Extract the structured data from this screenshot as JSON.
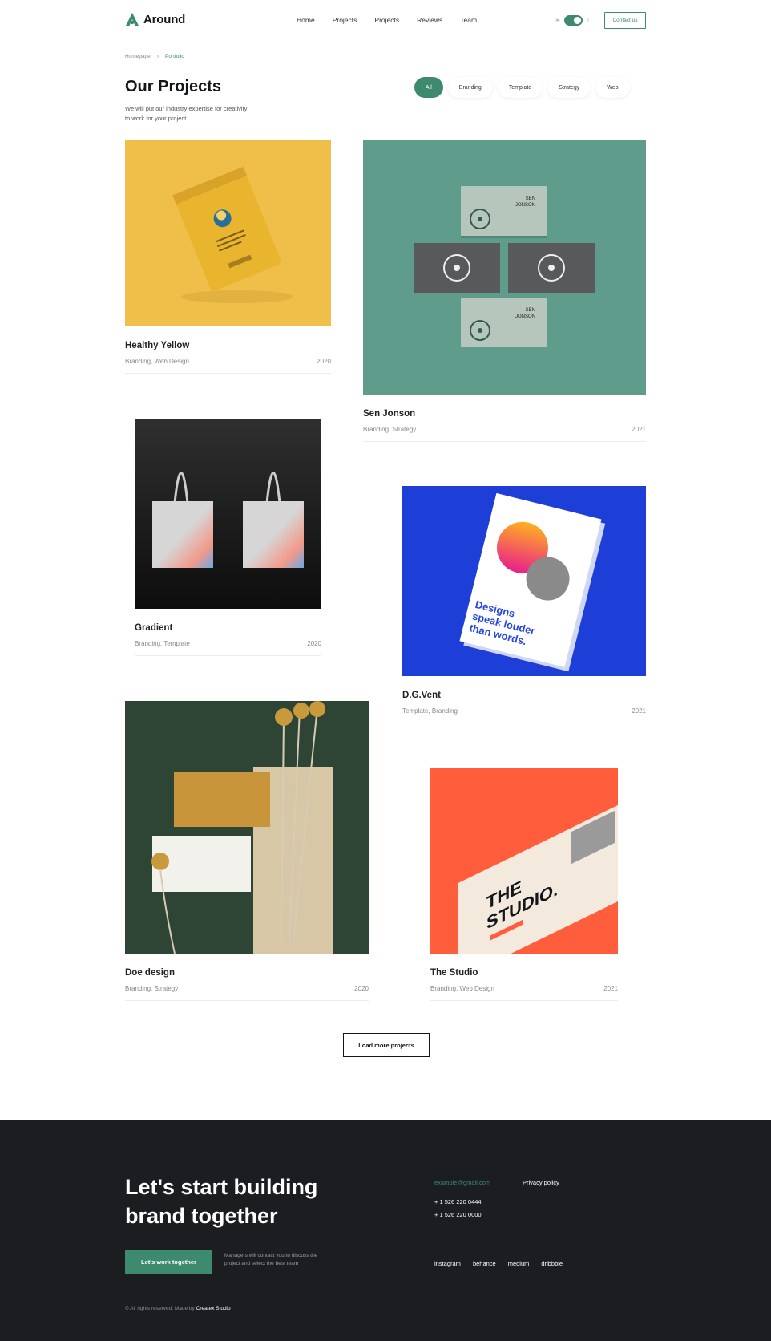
{
  "header": {
    "logo_text": "Around",
    "nav": [
      "Home",
      "Projects",
      "Projects",
      "Reviews",
      "Team"
    ],
    "contact_label": "Contact us"
  },
  "breadcrumb": {
    "home": "Homepage",
    "current": "Portfolio"
  },
  "page": {
    "title": "Our Projects",
    "subtitle": "We will put our industry expertise for creativity to work for your project"
  },
  "filters": [
    "All",
    "Branding",
    "Template",
    "Strategy",
    "Web"
  ],
  "projects": [
    {
      "name": "Healthy Yellow",
      "tags": "Branding, Web Design",
      "year": "2020"
    },
    {
      "name": "Sen Jonson",
      "tags": "Branding, Strategy",
      "year": "2021"
    },
    {
      "name": "Gradient",
      "tags": "Branding, Template",
      "year": "2020"
    },
    {
      "name": "D.G.Vent",
      "tags": "Template, Branding",
      "year": "2021"
    },
    {
      "name": "Doe design",
      "tags": "Branding, Strategy",
      "year": "2020"
    },
    {
      "name": "The Studio",
      "tags": "Branding, Web Design",
      "year": "2021"
    }
  ],
  "load_more_label": "Load more projects",
  "footer": {
    "heading_line1": "Let's start building",
    "heading_line2": "brand together",
    "cta_label": "Let's work together",
    "note": "Managers will contact you to discuss the project and select the best team",
    "email": "example@gmail.com",
    "privacy": "Privacy policy",
    "phone1": "+ 1 526 220 0444",
    "phone2": "+ 1 526 220 0000",
    "social": [
      "instagram",
      "behance",
      "medium",
      "dribbble"
    ],
    "copyright_prefix": "© All rights reserved. Made by",
    "copyright_brand": "Createx Studio"
  },
  "colors": {
    "accent": "#3e8a6e",
    "footer_bg": "#1b1d21"
  }
}
